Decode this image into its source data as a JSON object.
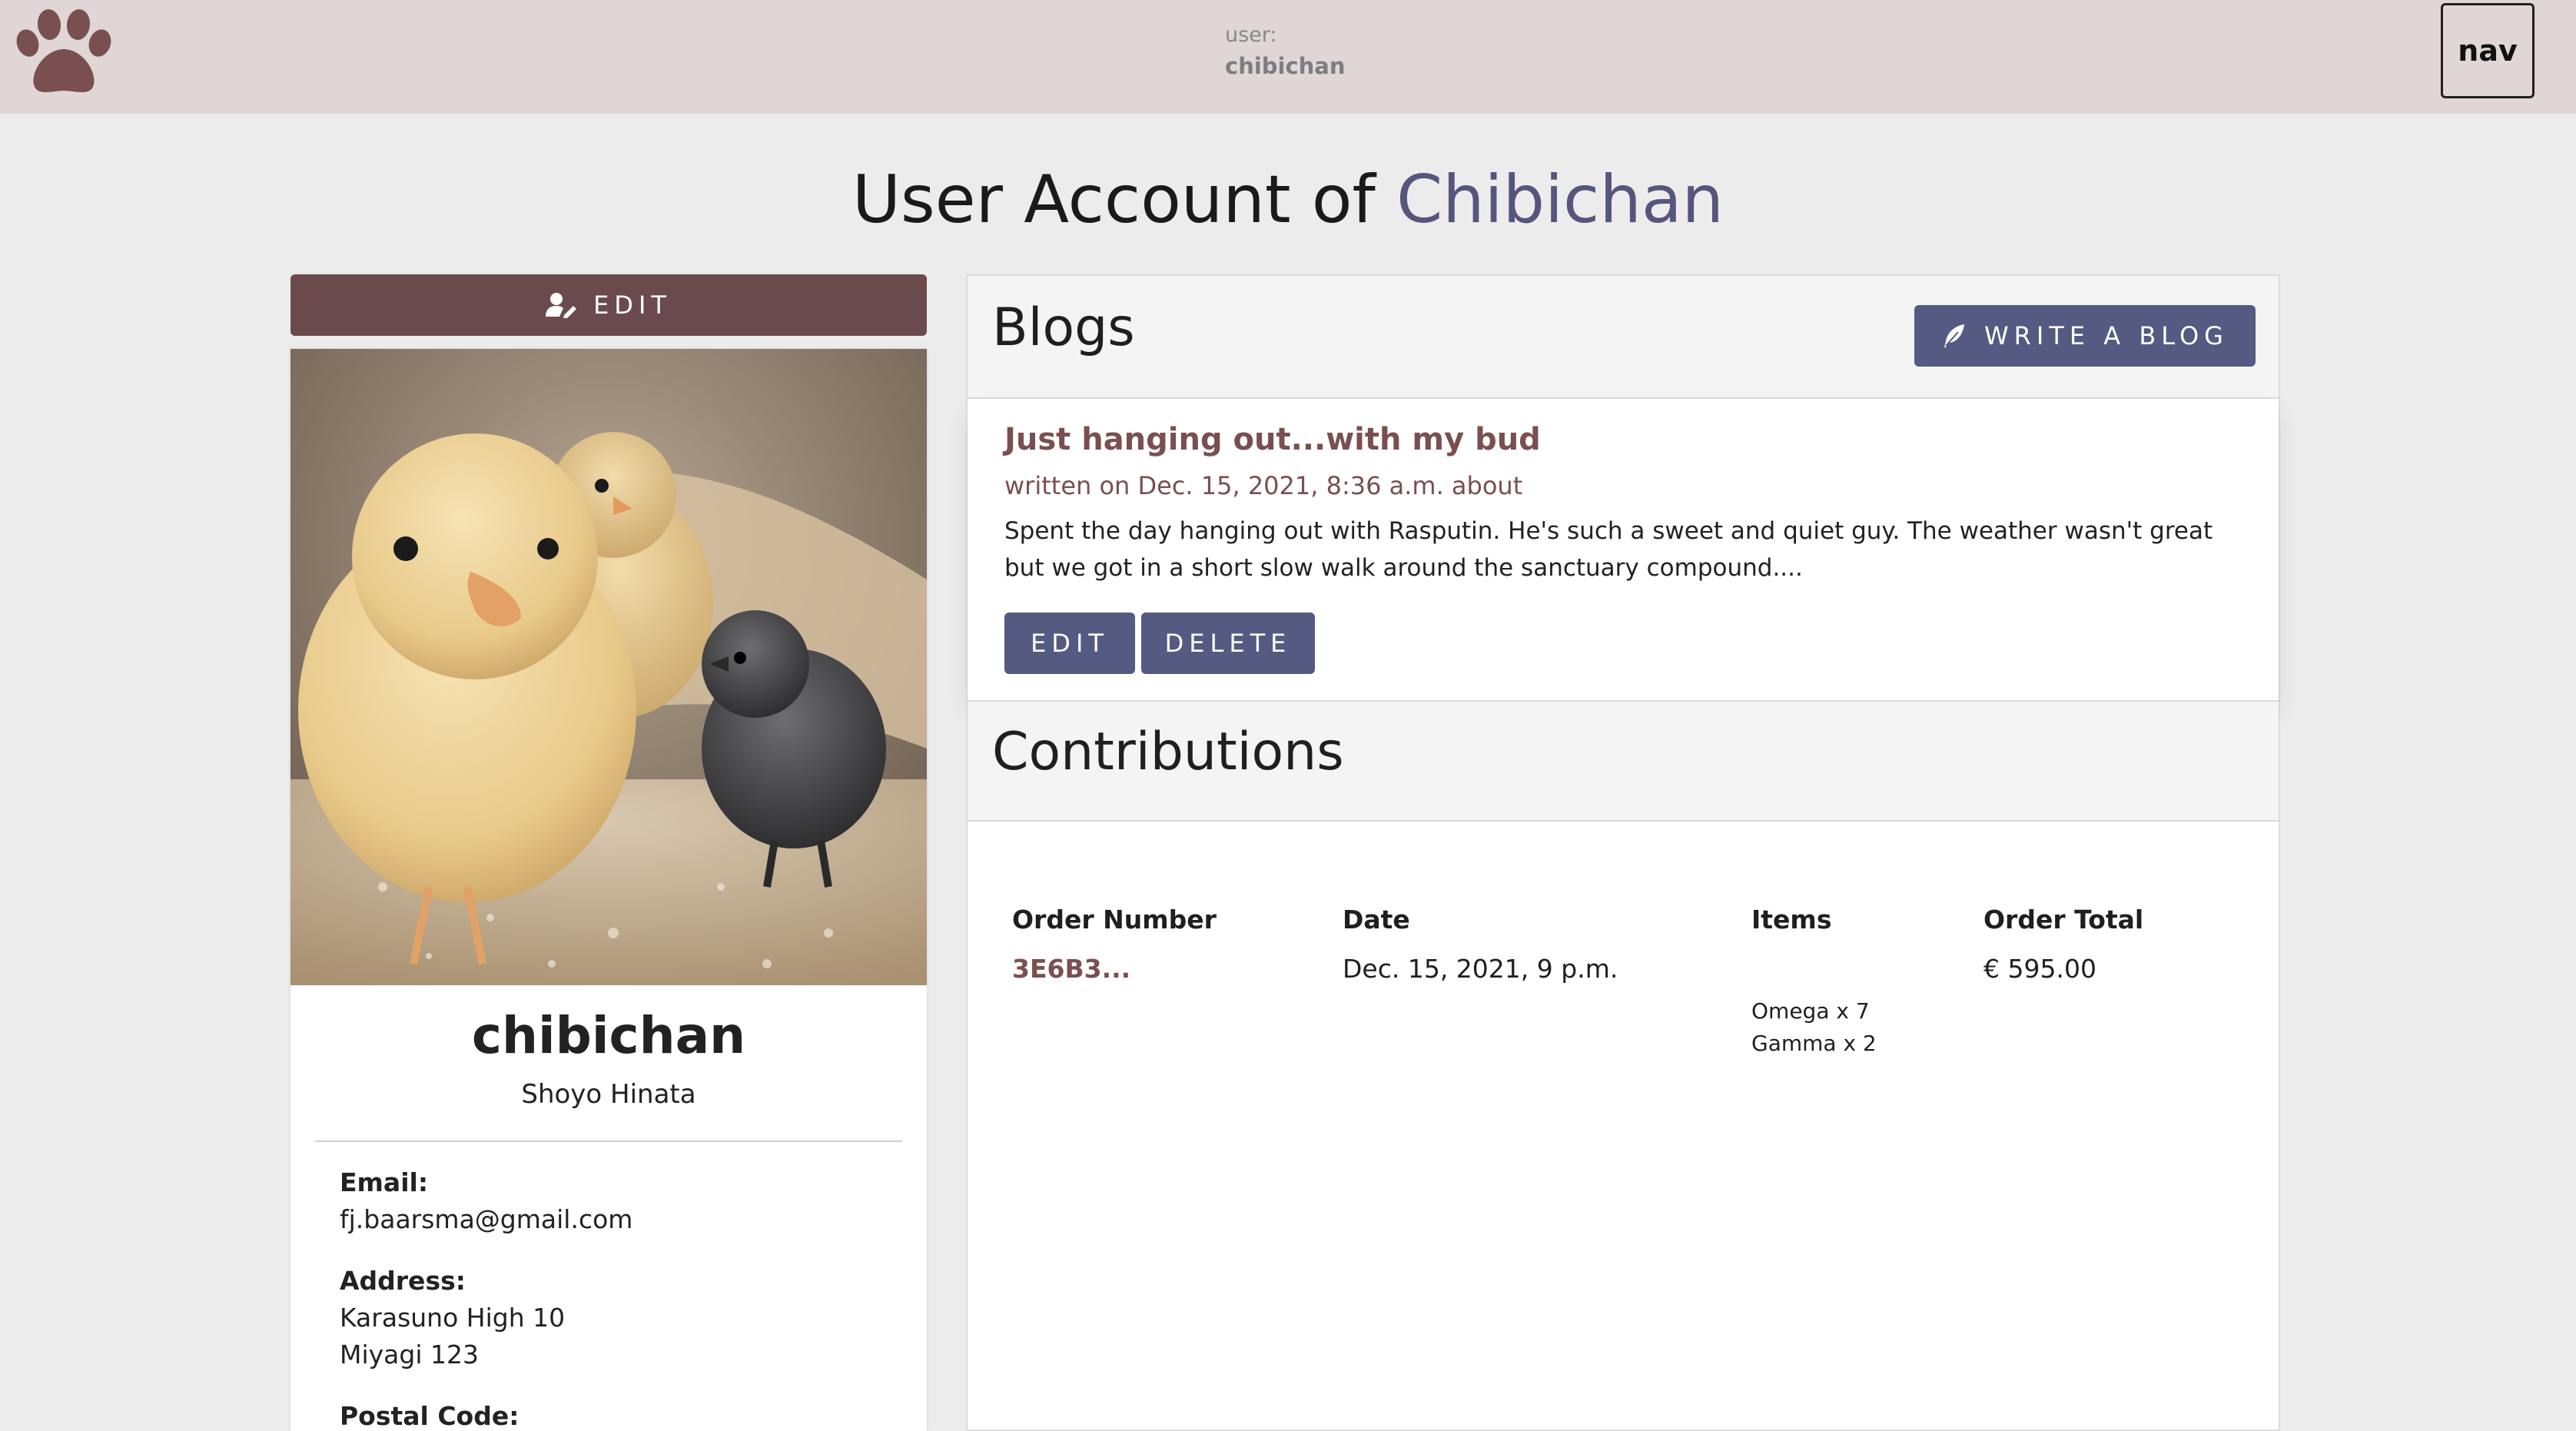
{
  "topbar": {
    "logo_icon": "paw-icon",
    "user_caption": "user:",
    "user_name": "chibichan",
    "nav_label": "nav"
  },
  "page": {
    "title_prefix": "User Account of ",
    "title_name": "Chibichan"
  },
  "profile": {
    "edit_label": "EDIT",
    "edit_icon": "user-edit-icon",
    "photo_alt": "chicks photo",
    "username": "chibichan",
    "full_name": "Shoyo Hinata",
    "email_label": "Email:",
    "email": "fj.baarsma@gmail.com",
    "address_label": "Address:",
    "address_line1": "Karasuno High 10",
    "address_line2": "Miyagi 123",
    "postal_label": "Postal Code:"
  },
  "blogs": {
    "title": "Blogs",
    "write_label": "WRITE A BLOG",
    "write_icon": "feather-icon",
    "post": {
      "title": "Just hanging out...with my bud",
      "meta": "written on Dec. 15, 2021, 8:36 a.m. about",
      "excerpt": "Spent the day hanging out with Rasputin. He's such a sweet and quiet guy. The weather wasn't great but we got in a short slow walk around the sanctuary compound....",
      "edit_label": "EDIT",
      "delete_label": "DELETE"
    }
  },
  "contributions": {
    "title": "Contributions",
    "columns": [
      "Order Number",
      "Date",
      "Items",
      "Order Total"
    ],
    "orders": [
      {
        "number": "3E6B3...",
        "date": "Dec. 15, 2021, 9 p.m.",
        "items": [
          "Omega x 7",
          "Gamma x 2"
        ],
        "total": "€ 595.00"
      }
    ]
  },
  "colors": {
    "topbar_bg": "#e0d6d6",
    "page_bg": "#ececec",
    "brand_brown": "#6b4a4d",
    "accent_purple": "#545a82",
    "link_brown": "#7a4f50"
  }
}
